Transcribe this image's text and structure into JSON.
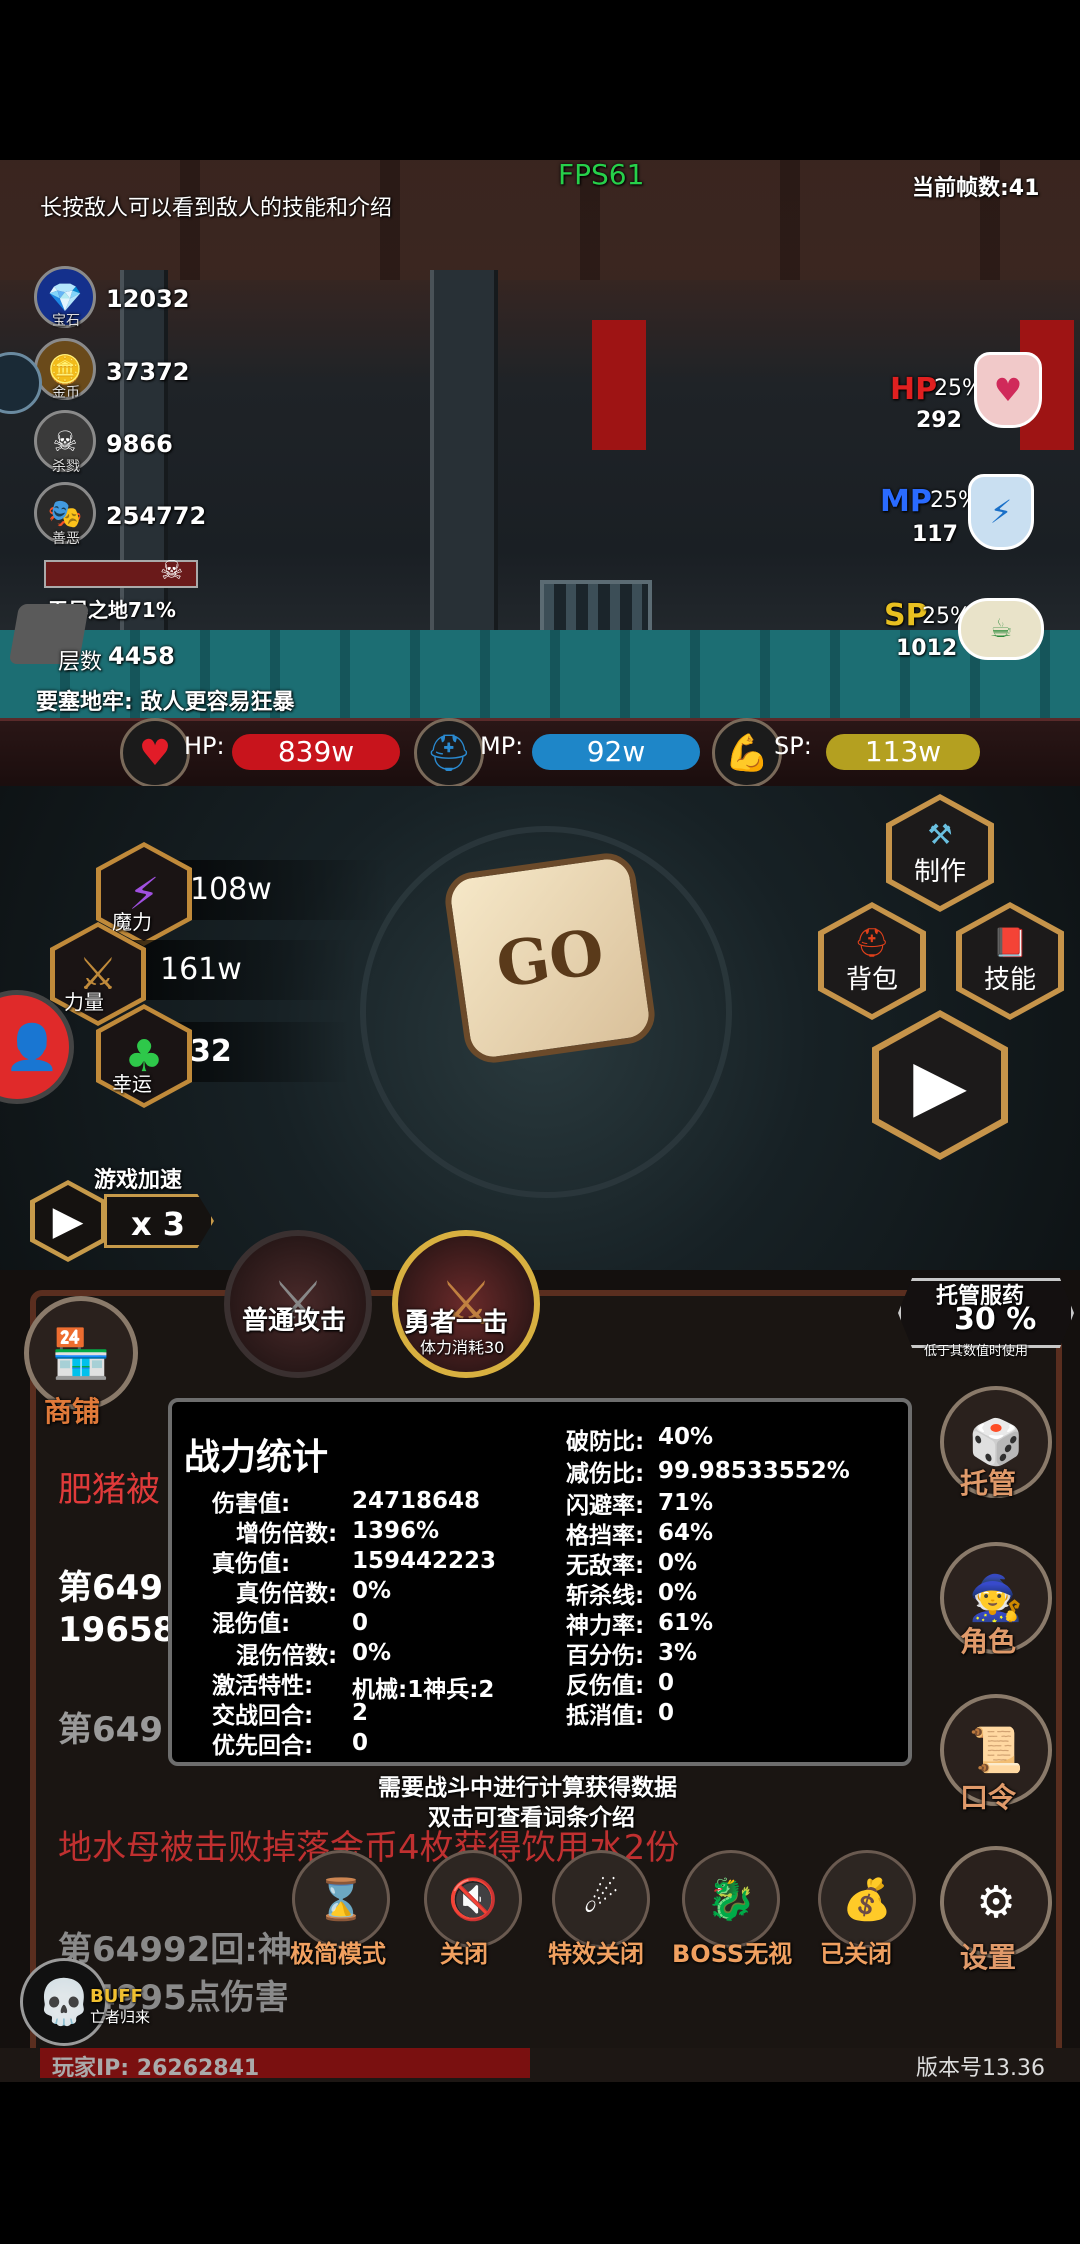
{
  "hud": {
    "fps": "FPS61",
    "frame_count": "当前帧数:41",
    "hint": "长按敌人可以看到敌人的技能和介绍"
  },
  "resources": [
    {
      "label": "宝石",
      "value": "12032",
      "icon": "gem-icon"
    },
    {
      "label": "金币",
      "value": "37372",
      "icon": "coin-icon"
    },
    {
      "label": "杀戮",
      "value": "9866",
      "icon": "skull-icon"
    },
    {
      "label": "善恶",
      "value": "254772",
      "icon": "mask-icon"
    }
  ],
  "dungeon": {
    "progress_label": "无尽之地71%",
    "floor_label": "层数",
    "floor_value": "4458",
    "modifier": "要塞地牢: 敌人更容易狂暴"
  },
  "potions": [
    {
      "stat": "HP",
      "percent": "25%",
      "count": "292",
      "color": "#e02020"
    },
    {
      "stat": "MP",
      "percent": "25%",
      "count": "117",
      "color": "#2a6bff"
    },
    {
      "stat": "SP",
      "percent": "25%",
      "count": "1012",
      "color": "#e8c020"
    }
  ],
  "bars": [
    {
      "label": "HP:",
      "value": "839w",
      "color": "#c8141c",
      "icon": "heart-icon"
    },
    {
      "label": "MP:",
      "value": "92w",
      "color": "#1e86c8",
      "icon": "helmet-icon"
    },
    {
      "label": "SP:",
      "value": "113w",
      "color": "#b4a020",
      "icon": "muscle-icon"
    }
  ],
  "stats": [
    {
      "label": "魔力",
      "value": "108w",
      "icon": "magic-bolt-icon"
    },
    {
      "label": "力量",
      "value": "161w",
      "icon": "sword-icon"
    },
    {
      "label": "幸运",
      "value": "32",
      "icon": "clover-icon"
    }
  ],
  "dice_label": "GO",
  "menu": {
    "craft": "制作",
    "bag": "背包",
    "skill": "技能"
  },
  "speed": {
    "title": "游戏加速",
    "value": "x 3"
  },
  "attacks": {
    "normal": "普通攻击",
    "brave": "勇者一击",
    "brave_cost": "体力消耗30"
  },
  "auto_potion": {
    "title": "托管服药",
    "percent": "30 %",
    "note": "低于其数值时使用"
  },
  "shop": "商铺",
  "side_buttons": {
    "auto": "托管",
    "character": "角色",
    "code": "口令",
    "settings": "设置"
  },
  "log_lines": [
    {
      "text": "肥猪被",
      "color": "#e03a3a"
    },
    {
      "text": "第649",
      "color": "#ffffff"
    },
    {
      "text": "19658",
      "color": "#ffffff"
    },
    {
      "text": "第649",
      "color": "#9a9a9a"
    },
    {
      "text": "地水母被击败掉落金币4枚获得饮用水2份",
      "color": "#c03030"
    },
    {
      "text": "第64992回:神",
      "color": "#8a8a8a"
    },
    {
      "text": "4995点伤害",
      "color": "#8a8a8a"
    }
  ],
  "popup": {
    "title": "战力统计",
    "left": [
      {
        "label": "伤害值:",
        "value": "24718648",
        "indent": false
      },
      {
        "label": "增伤倍数:",
        "value": "1396%",
        "indent": true
      },
      {
        "label": "真伤值:",
        "value": "159442223",
        "indent": false
      },
      {
        "label": "真伤倍数:",
        "value": "0%",
        "indent": true
      },
      {
        "label": "混伤值:",
        "value": "0",
        "indent": false
      },
      {
        "label": "混伤倍数:",
        "value": "0%",
        "indent": true
      },
      {
        "label": "激活特性:",
        "value": "机械:1神兵:2",
        "indent": false
      },
      {
        "label": "交战回合:",
        "value": "2",
        "indent": false
      },
      {
        "label": "优先回合:",
        "value": "0",
        "indent": false
      }
    ],
    "right": [
      {
        "label": "破防比:",
        "value": "40%"
      },
      {
        "label": "减伤比:",
        "value": "99.98533552%"
      },
      {
        "label": "闪避率:",
        "value": "71%"
      },
      {
        "label": "格挡率:",
        "value": "64%"
      },
      {
        "label": "无敌率:",
        "value": "0%"
      },
      {
        "label": "斩杀线:",
        "value": "0%"
      },
      {
        "label": "神力率:",
        "value": "61%"
      },
      {
        "label": "百分伤:",
        "value": "3%"
      },
      {
        "label": "反伤值:",
        "value": "0"
      },
      {
        "label": "抵消值:",
        "value": "0"
      }
    ],
    "footer1": "需要战斗中进行计算获得数据",
    "footer2": "双击可查看词条介绍"
  },
  "bottom_buttons": [
    {
      "label": "极简模式",
      "icon": "hourglass-icon"
    },
    {
      "label": "关闭",
      "icon": "mute-icon"
    },
    {
      "label": "特效关闭",
      "icon": "comet-icon"
    },
    {
      "label": "BOSS无视",
      "icon": "dragon-icon"
    },
    {
      "label": "已关闭",
      "icon": "bag-icon"
    }
  ],
  "buff": {
    "label": "BUFF",
    "name": "亡者归来"
  },
  "footer": {
    "player_ip": "玩家IP:  26262841",
    "version": "版本号13.36"
  }
}
